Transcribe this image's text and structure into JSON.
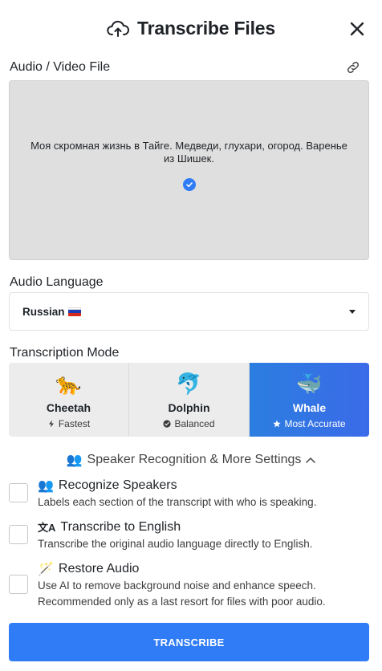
{
  "header": {
    "title": "Transcribe Files",
    "icon": "cloud-upload-icon",
    "close_icon": "close-icon"
  },
  "file": {
    "label": "Audio / Video File",
    "link_icon": "link-icon",
    "file_name": "Моя скромная жизнь в Тайге. Медведи, глухари, огород. Варенье из Шишек.",
    "status_icon": "check-circle-icon",
    "status_color": "#2f7cf6"
  },
  "language": {
    "label": "Audio Language",
    "selected": "Russian",
    "flag": "russia-flag-icon"
  },
  "mode": {
    "label": "Transcription Mode",
    "options": [
      {
        "emoji": "🐆",
        "name": "Cheetah",
        "sub": "Fastest",
        "sub_icon": "lightning-icon",
        "active": false
      },
      {
        "emoji": "🐬",
        "name": "Dolphin",
        "sub": "Balanced",
        "sub_icon": "check-badge-icon",
        "active": false
      },
      {
        "emoji": "🐳",
        "name": "Whale",
        "sub": "Most Accurate",
        "sub_icon": "star-icon",
        "active": true
      }
    ],
    "active_color": "#2f7cf6"
  },
  "more_settings": {
    "emoji": "👥",
    "label": "Speaker Recognition & More Settings",
    "chevron": "chevron-up-icon"
  },
  "options": [
    {
      "emoji": "👥",
      "title": "Recognize Speakers",
      "desc": "Labels each section of the transcript with who is speaking.",
      "checked": false
    },
    {
      "emoji": "文A",
      "title": "Transcribe to English",
      "desc": "Transcribe the original audio language directly to English.",
      "checked": false
    },
    {
      "emoji": "🪄",
      "title": "Restore Audio",
      "desc": "Use AI to remove background noise and enhance speech. Recommended only as a last resort for files with poor audio.",
      "checked": false
    }
  ],
  "action": {
    "transcribe_label": "TRANSCRIBE",
    "color": "#2f7cf6"
  }
}
